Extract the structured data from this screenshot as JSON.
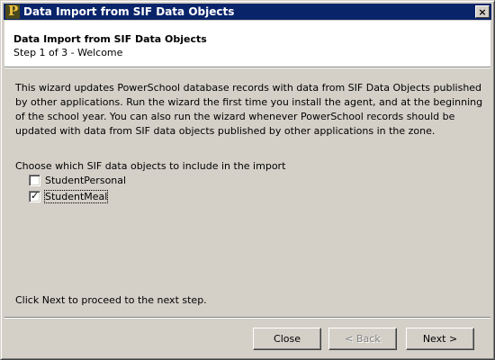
{
  "window": {
    "title": "Data Import from SIF Data Objects",
    "close_glyph": "×",
    "icon": "powerschool-p-icon",
    "icon_glyph": "P"
  },
  "header": {
    "title": "Data Import from SIF Data Objects",
    "subtitle": "Step 1 of 3 - Welcome"
  },
  "body": {
    "description": "This wizard updates PowerSchool database records with data from SIF Data Objects published by other applications.  Run the wizard the first time you install the agent, and at the beginning of the school year. You can also run the wizard whenever PowerSchool records should be updated with data from SIF data objects published by other applications in the zone.",
    "choose_label": "Choose which SIF data objects to include in the import",
    "objects": [
      {
        "label": "StudentPersonal",
        "checked": false
      },
      {
        "label": "StudentMeal",
        "checked": true
      }
    ],
    "footer_text": "Click Next to proceed to the next step."
  },
  "buttons": {
    "close": "Close",
    "back": "< Back",
    "next": "Next >"
  }
}
